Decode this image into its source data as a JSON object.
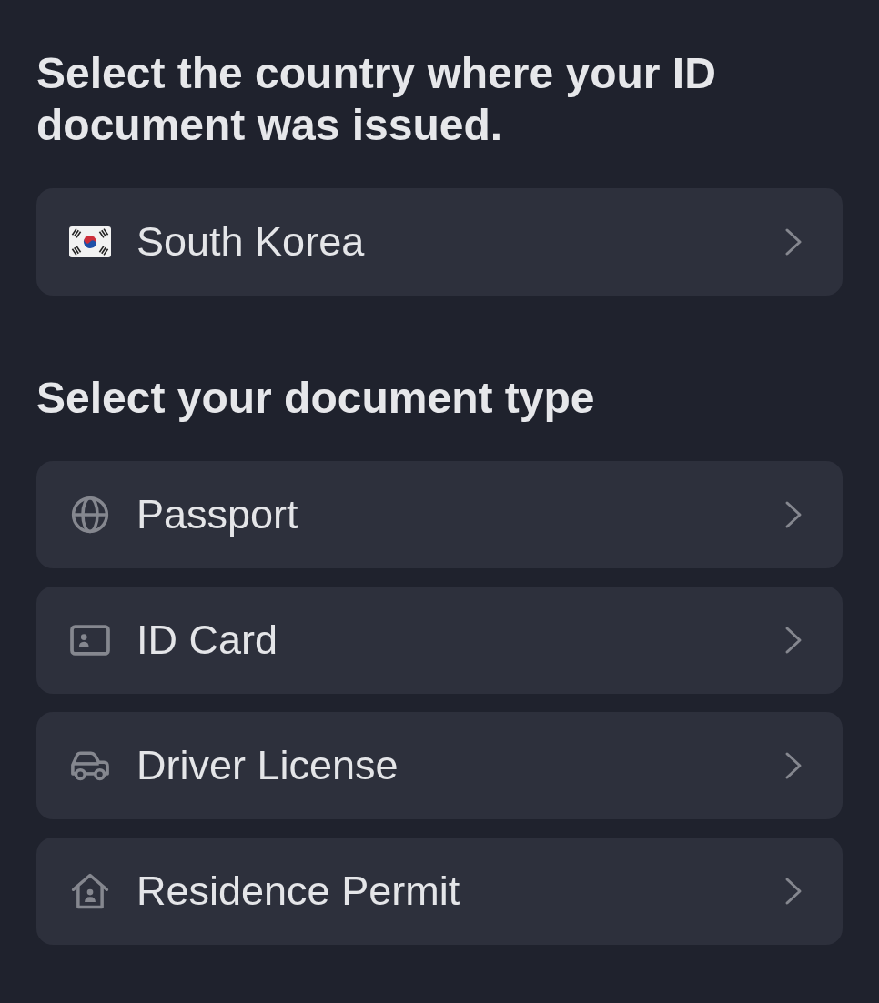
{
  "country_prompt": "Select the country where your ID document was issued.",
  "country_select": {
    "label": "South Korea"
  },
  "document_prompt": "Select your document type",
  "document_types": [
    {
      "kind": "globe",
      "label": "Passport"
    },
    {
      "kind": "id-card",
      "label": "ID Card"
    },
    {
      "kind": "car",
      "label": "Driver License"
    },
    {
      "kind": "house",
      "label": "Residence Permit"
    }
  ]
}
